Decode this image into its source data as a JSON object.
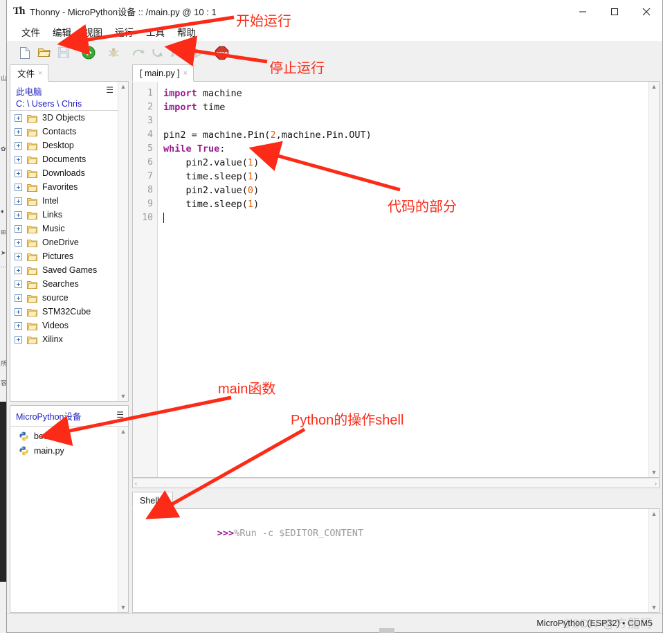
{
  "window": {
    "title": "Thonny  -  MicroPython设备 :: /main.py  @  10 : 1",
    "app_icon": "thonny-logo-icon",
    "controls": {
      "minimize": "minimize-icon",
      "maximize": "maximize-icon",
      "close": "close-icon"
    }
  },
  "menubar": {
    "items": [
      {
        "label": "文件"
      },
      {
        "label": "编辑"
      },
      {
        "label": "视图"
      },
      {
        "label": "运行"
      },
      {
        "label": "工具"
      },
      {
        "label": "帮助"
      }
    ]
  },
  "toolbar": {
    "buttons": [
      {
        "name": "new-file-button",
        "icon": "new-file-icon",
        "enabled": true
      },
      {
        "name": "open-file-button",
        "icon": "open-folder-icon",
        "enabled": true
      },
      {
        "name": "save-file-button",
        "icon": "save-disk-icon",
        "enabled": false
      },
      {
        "name": "run-button",
        "icon": "run-play-icon",
        "enabled": true
      },
      {
        "name": "debug-button",
        "icon": "debug-bug-icon",
        "enabled": false
      },
      {
        "name": "step-over-button",
        "icon": "step-over-icon",
        "enabled": false
      },
      {
        "name": "step-into-button",
        "icon": "step-into-icon",
        "enabled": false
      },
      {
        "name": "step-out-button",
        "icon": "step-out-icon",
        "enabled": false
      },
      {
        "name": "resume-button",
        "icon": "resume-icon",
        "enabled": false
      },
      {
        "name": "stop-button",
        "icon": "stop-sign-icon",
        "enabled": true
      }
    ]
  },
  "left_pane": {
    "tab": {
      "label": "文件",
      "close": "×"
    },
    "tree_header": {
      "root_label": "此电脑",
      "path": "C: \\ Users \\ Chris",
      "menu_icon": "hamburger-icon"
    },
    "folders": [
      {
        "label": "3D Objects"
      },
      {
        "label": "Contacts"
      },
      {
        "label": "Desktop"
      },
      {
        "label": "Documents"
      },
      {
        "label": "Downloads"
      },
      {
        "label": "Favorites"
      },
      {
        "label": "Intel"
      },
      {
        "label": "Links"
      },
      {
        "label": "Music"
      },
      {
        "label": "OneDrive"
      },
      {
        "label": "Pictures"
      },
      {
        "label": "Saved Games"
      },
      {
        "label": "Searches"
      },
      {
        "label": "source"
      },
      {
        "label": "STM32Cube"
      },
      {
        "label": "Videos"
      },
      {
        "label": "Xilinx"
      }
    ],
    "device_panel": {
      "title": "MicroPython设备",
      "menu_icon": "hamburger-icon",
      "files": [
        {
          "label": "boot.py"
        },
        {
          "label": "main.py"
        }
      ]
    }
  },
  "editor": {
    "tab": {
      "label": "[ main.py ]",
      "close": "×"
    },
    "line_numbers": [
      "1",
      "2",
      "3",
      "4",
      "5",
      "6",
      "7",
      "8",
      "9",
      "10"
    ],
    "lines": [
      [
        {
          "t": "import",
          "c": "kw"
        },
        {
          "t": " machine",
          "c": ""
        }
      ],
      [
        {
          "t": "import",
          "c": "kw"
        },
        {
          "t": " time",
          "c": ""
        }
      ],
      [],
      [
        {
          "t": "pin2 = machine.Pin(",
          "c": ""
        },
        {
          "t": "2",
          "c": "num"
        },
        {
          "t": ",machine.Pin.OUT)",
          "c": ""
        }
      ],
      [
        {
          "t": "while",
          "c": "kw"
        },
        {
          "t": " ",
          "c": ""
        },
        {
          "t": "True",
          "c": "kw"
        },
        {
          "t": ":",
          "c": ""
        }
      ],
      [
        {
          "t": "    pin2.value(",
          "c": ""
        },
        {
          "t": "1",
          "c": "num"
        },
        {
          "t": ")",
          "c": ""
        }
      ],
      [
        {
          "t": "    time.sleep(",
          "c": ""
        },
        {
          "t": "1",
          "c": "num"
        },
        {
          "t": ")",
          "c": ""
        }
      ],
      [
        {
          "t": "    pin2.value(",
          "c": ""
        },
        {
          "t": "0",
          "c": "num"
        },
        {
          "t": ")",
          "c": ""
        }
      ],
      [
        {
          "t": "    time.sleep(",
          "c": ""
        },
        {
          "t": "1",
          "c": "num"
        },
        {
          "t": ")",
          "c": ""
        }
      ],
      []
    ],
    "scrollbar": {
      "up": "▲",
      "down": "▼",
      "left": "‹",
      "right": "›"
    }
  },
  "shell": {
    "tab": {
      "label": "Shell",
      "close": "×"
    },
    "prompt": ">>>",
    "command": "%Run -c $EDITOR_CONTENT"
  },
  "statusbar": {
    "interpreter": "MicroPython (ESP32) • COM5"
  },
  "watermark": {
    "text": "CSDN @方龍吗"
  },
  "annotations": [
    {
      "id": "anno-start",
      "text": "开始运行"
    },
    {
      "id": "anno-stop",
      "text": "停止运行"
    },
    {
      "id": "anno-code",
      "text": "代码的部分"
    },
    {
      "id": "anno-main",
      "text": "main函数"
    },
    {
      "id": "anno-shell",
      "text": "Python的操作shell"
    }
  ],
  "colors": {
    "annotation_red": "#fb2b18",
    "keyword_purple": "#9b1a8f",
    "number_orange": "#e06000",
    "tree_blue": "#2020c0",
    "window_bg": "#f0f0f0"
  }
}
